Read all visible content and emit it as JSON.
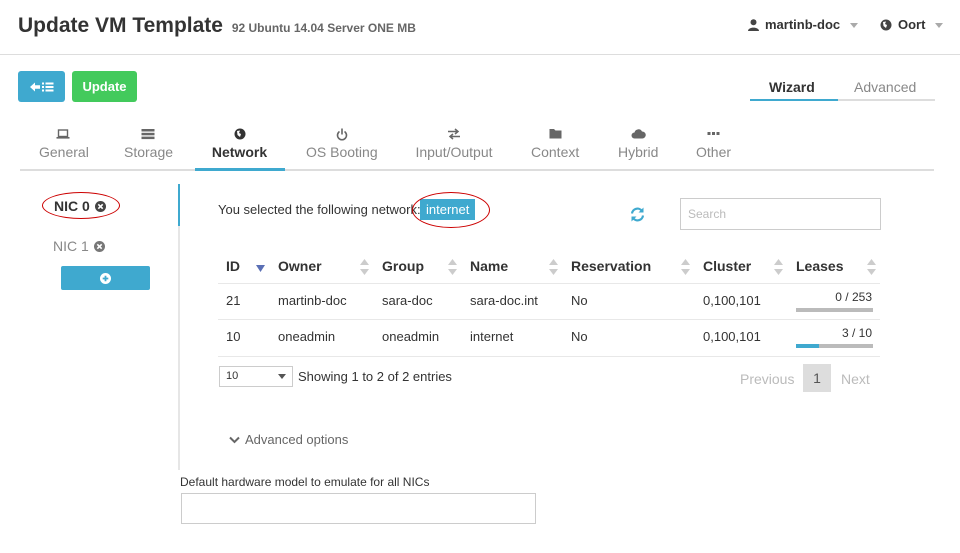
{
  "header": {
    "title": "Update VM Template",
    "subtitle": "92  Ubuntu 14.04 Server ONE MB",
    "user": "martinb-doc",
    "zone": "Oort",
    "user_icon": "user-icon",
    "zone_icon": "globe-icon"
  },
  "toolbar": {
    "back_icon": "arrow-left-list-icon",
    "update_label": "Update"
  },
  "mode_tabs": {
    "wizard": "Wizard",
    "advanced": "Advanced",
    "active": "Wizard"
  },
  "tabs": [
    {
      "label": "General",
      "icon": "laptop-icon"
    },
    {
      "label": "Storage",
      "icon": "storage-icon"
    },
    {
      "label": "Network",
      "icon": "globe-icon"
    },
    {
      "label": "OS Booting",
      "icon": "power-icon"
    },
    {
      "label": "Input/Output",
      "icon": "exchange-icon"
    },
    {
      "label": "Context",
      "icon": "folder-icon"
    },
    {
      "label": "Hybrid",
      "icon": "cloud-icon"
    },
    {
      "label": "Other",
      "icon": "ellipsis-icon"
    }
  ],
  "active_tab": "Network",
  "nics": [
    {
      "label": "NIC 0",
      "selected": true
    },
    {
      "label": "NIC 1",
      "selected": false
    }
  ],
  "add_nic_icon": "plus-circle-icon",
  "network": {
    "selected_text": "You selected the following network:",
    "selected_name": "internet",
    "search_placeholder": "Search"
  },
  "table": {
    "columns": [
      "ID",
      "Owner",
      "Group",
      "Name",
      "Reservation",
      "Cluster",
      "Leases"
    ],
    "sorted_column": "ID",
    "rows": [
      {
        "id": "21",
        "owner": "martinb-doc",
        "group": "sara-doc",
        "name": "sara-doc.int",
        "reservation": "No",
        "cluster": "0,100,101",
        "leases": "0 / 253",
        "lease_fraction": 0.0
      },
      {
        "id": "10",
        "owner": "oneadmin",
        "group": "oneadmin",
        "name": "internet",
        "reservation": "No",
        "cluster": "0,100,101",
        "leases": "3 / 10",
        "lease_fraction": 0.3
      }
    ],
    "page_length": "10",
    "showing": "Showing 1 to 2 of 2 entries",
    "pagination": {
      "previous": "Previous",
      "page": "1",
      "next": "Next"
    }
  },
  "advanced_options": "Advanced options",
  "hardware": {
    "label": "Default hardware model to emulate for all NICs",
    "value": ""
  },
  "colors": {
    "accent": "#3fa9cf",
    "update": "#43ca5c",
    "annotation": "#cc0000"
  }
}
